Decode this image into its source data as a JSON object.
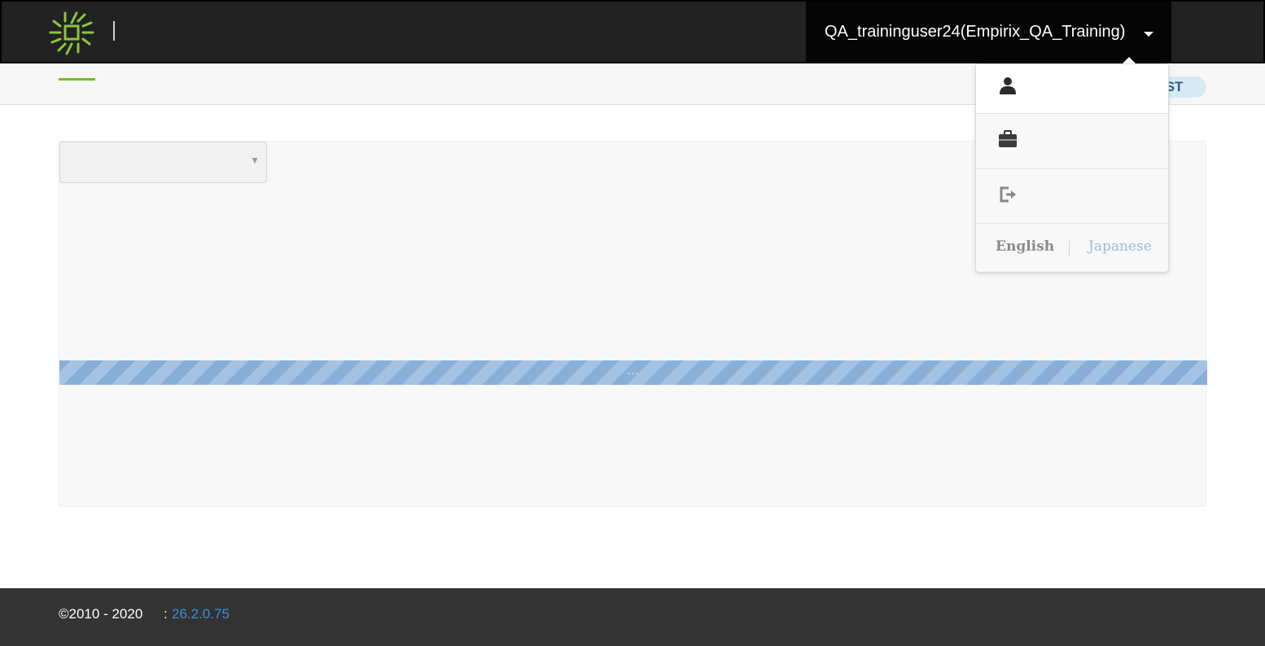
{
  "header": {
    "user_label": "QA_traininguser24(Empirix_QA_Training)"
  },
  "subnav": {
    "timezone_badge": "IST"
  },
  "main": {
    "selector_value": "",
    "loading_text": "..."
  },
  "user_dropdown": {
    "items": [
      {
        "icon": "user-icon"
      },
      {
        "icon": "briefcase-icon"
      },
      {
        "icon": "logout-icon"
      }
    ],
    "languages": {
      "english": "English",
      "japanese": "Japanese"
    }
  },
  "footer": {
    "copyright": "©2010 - 2020",
    "separator": ":",
    "version": "26.2.0.75"
  },
  "colors": {
    "header_bg": "#222222",
    "accent_green": "#7ab829",
    "loading_blue": "#89afd9",
    "footer_bg": "#333333",
    "version_link": "#3f8fd6"
  }
}
